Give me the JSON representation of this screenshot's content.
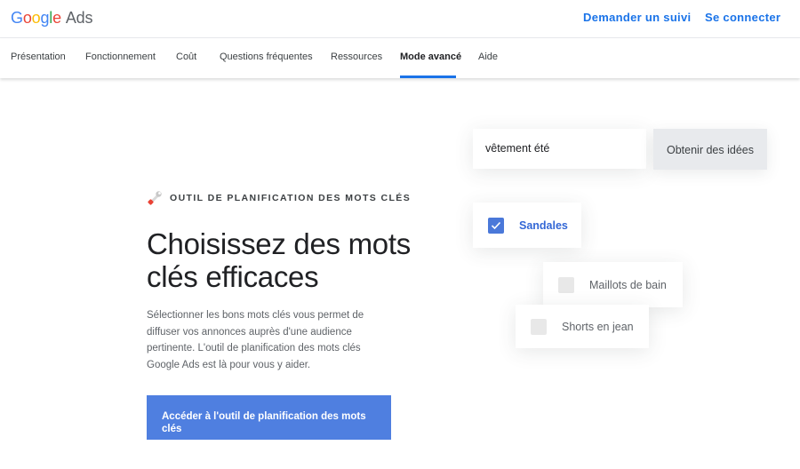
{
  "header": {
    "logo_google": "Google",
    "logo_ads": "Ads",
    "contact_link": "Demander un suivi",
    "signin_link": "Se connecter"
  },
  "nav": {
    "items": [
      {
        "label": "Présentation"
      },
      {
        "label": "Fonctionnement"
      },
      {
        "label": "Coût"
      },
      {
        "label": "Questions fréquentes"
      },
      {
        "label": "Ressources"
      },
      {
        "label": "Mode avancé",
        "active": true
      },
      {
        "label": "Aide"
      }
    ]
  },
  "hero": {
    "eyebrow": "OUTIL DE PLANIFICATION DES MOTS CLÉS",
    "headline": "Choisissez des mots clés efficaces",
    "body": "Sélectionner les bons mots clés vous permet de diffuser vos annonces auprès d'une audience pertinente. L'outil de planification des mots clés Google Ads est là pour vous y aider.",
    "cta": "Accéder à l'outil de planification des mots clés"
  },
  "mockup": {
    "search_value": "vêtement été",
    "ideas_button": "Obtenir des idées",
    "keywords": [
      {
        "label": "Sandales",
        "checked": true
      },
      {
        "label": "Maillots de bain",
        "checked": false
      },
      {
        "label": "Shorts en jean",
        "checked": false
      }
    ]
  },
  "colors": {
    "accent": "#1a73e8",
    "cta_background": "#4f7fe0",
    "checkbox_checked": "#4a78d9"
  },
  "icons": {
    "eyebrow": "wrench-icon",
    "checkbox": "checkmark-icon"
  }
}
